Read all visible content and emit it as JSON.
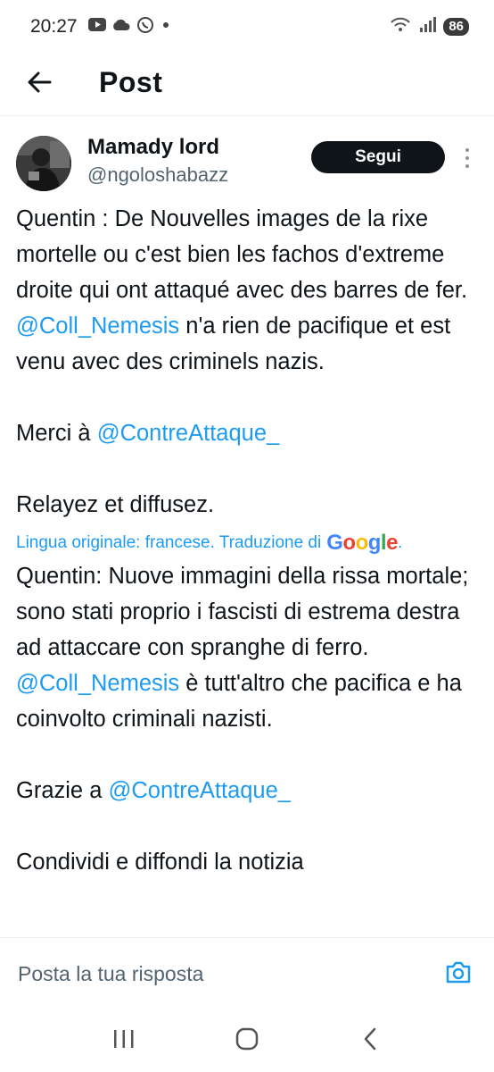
{
  "status_bar": {
    "time": "20:27",
    "battery": "86"
  },
  "header": {
    "title": "Post"
  },
  "author": {
    "name": "Mamady lord",
    "handle": "@ngoloshabazz",
    "follow_label": "Segui"
  },
  "post": {
    "original": {
      "p1_text": "Quentin : De Nouvelles images de la rixe mortelle ou c'est bien les fachos d'extreme droite qui ont attaqué avec des barres de fer. ",
      "p1_mention": "@Coll_Nemesis",
      "p1_rest": " n'a rien de pacifique et est venu avec des criminels nazis.",
      "p2_text": "Merci à ",
      "p2_mention": "@ContreAttaque_",
      "p3_text": "Relayez et diffusez."
    },
    "translation_note": "Lingua originale: francese. Traduzione di",
    "translation_provider": "Google",
    "translated": {
      "p1_text": "Quentin: Nuove immagini della rissa mortale; sono stati proprio i fascisti di estrema destra ad attaccare con spranghe di ferro. ",
      "p1_mention": "@Coll_Nemesis",
      "p1_rest": " è tutt'altro che pacifica e ha coinvolto criminali nazisti.",
      "p2_text": "Grazie a ",
      "p2_mention": "@ContreAttaque_",
      "p3_partial": "Condividi e diffondi la notizia"
    }
  },
  "reply": {
    "placeholder": "Posta la tua risposta"
  },
  "colors": {
    "accent": "#1d9bf0",
    "text": "#0f1419",
    "muted": "#536471"
  },
  "icons": {
    "back": "arrow-left-icon",
    "more": "more-vertical-icon",
    "camera": "camera-icon",
    "nav_recents": "recents-icon",
    "nav_home": "home-icon",
    "nav_back": "nav-back-icon"
  }
}
